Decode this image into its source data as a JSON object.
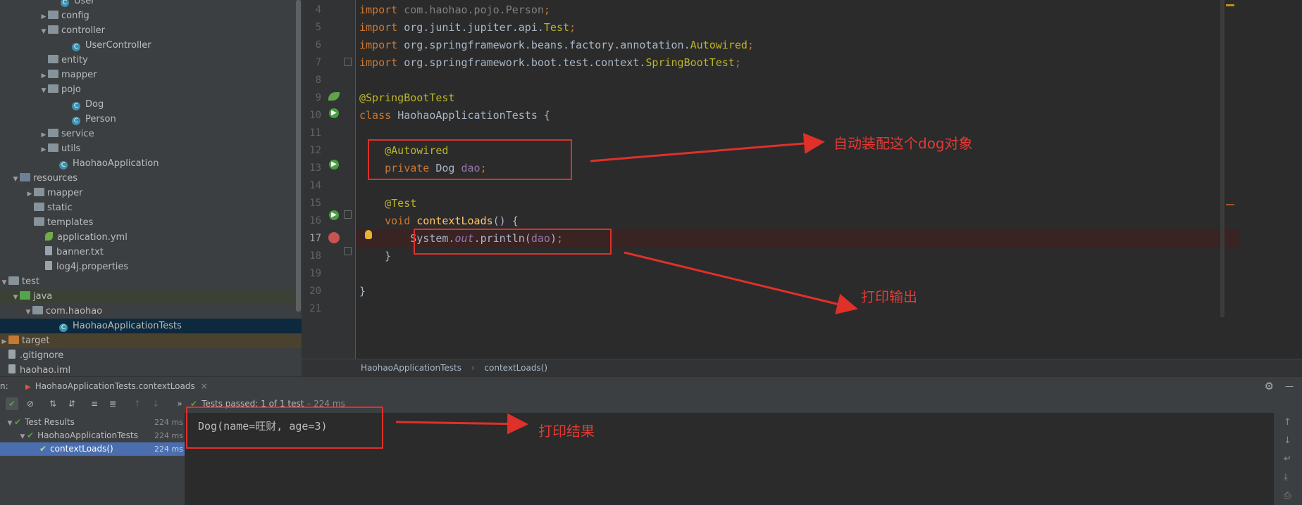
{
  "project_tree": [
    {
      "label": "User",
      "indent": 88,
      "icon": "class",
      "arrow": ""
    },
    {
      "label": "config",
      "indent": 70,
      "icon": "folder",
      "arrow": "▶"
    },
    {
      "label": "controller",
      "indent": 70,
      "icon": "folder",
      "arrow": "▼"
    },
    {
      "label": "UserController",
      "indent": 104,
      "icon": "class",
      "arrow": ""
    },
    {
      "label": "entity",
      "indent": 70,
      "icon": "folder",
      "arrow": ""
    },
    {
      "label": "mapper",
      "indent": 70,
      "icon": "folder",
      "arrow": "▶"
    },
    {
      "label": "pojo",
      "indent": 70,
      "icon": "folder",
      "arrow": "▼"
    },
    {
      "label": "Dog",
      "indent": 104,
      "icon": "class",
      "arrow": ""
    },
    {
      "label": "Person",
      "indent": 104,
      "icon": "class",
      "arrow": ""
    },
    {
      "label": "service",
      "indent": 70,
      "icon": "folder",
      "arrow": "▶"
    },
    {
      "label": "utils",
      "indent": 70,
      "icon": "folder",
      "arrow": "▶"
    },
    {
      "label": "HaohaoApplication",
      "indent": 86,
      "icon": "class",
      "arrow": ""
    },
    {
      "label": "resources",
      "indent": 30,
      "icon": "folder-src",
      "arrow": "▼"
    },
    {
      "label": "mapper",
      "indent": 50,
      "icon": "folder",
      "arrow": "▶"
    },
    {
      "label": "static",
      "indent": 50,
      "icon": "folder",
      "arrow": ""
    },
    {
      "label": "templates",
      "indent": 50,
      "icon": "folder",
      "arrow": ""
    },
    {
      "label": "application.yml",
      "indent": 66,
      "icon": "yml",
      "arrow": ""
    },
    {
      "label": "banner.txt",
      "indent": 66,
      "icon": "file",
      "arrow": ""
    },
    {
      "label": "log4j.properties",
      "indent": 66,
      "icon": "file",
      "arrow": ""
    },
    {
      "label": "test",
      "indent": 12,
      "icon": "folder",
      "arrow": "▼"
    },
    {
      "label": "java",
      "indent": 30,
      "icon": "folder-test",
      "arrow": "▼"
    },
    {
      "label": "com.haohao",
      "indent": 48,
      "icon": "folder",
      "arrow": "▼"
    },
    {
      "label": "HaohaoApplicationTests",
      "indent": 86,
      "icon": "class",
      "arrow": ""
    },
    {
      "label": "target",
      "indent": 0,
      "icon": "folder-orange",
      "arrow": "▶"
    },
    {
      "label": ".gitignore",
      "indent": 12,
      "icon": "file",
      "arrow": ""
    },
    {
      "label": "haohao.iml",
      "indent": 12,
      "icon": "file",
      "arrow": ""
    }
  ],
  "editor": {
    "line_numbers": [
      "4",
      "5",
      "6",
      "7",
      "8",
      "9",
      "10",
      "11",
      "12",
      "13",
      "14",
      "15",
      "16",
      "17",
      "18",
      "19",
      "20",
      "21"
    ],
    "lines": [
      [
        {
          "t": "import ",
          "c": "kw"
        },
        {
          "t": "com.haohao.pojo.Person",
          "c": "dim"
        },
        {
          "t": ";",
          "c": "kw"
        }
      ],
      [
        {
          "t": "import ",
          "c": "kw"
        },
        {
          "t": "org.junit.jupiter.api.",
          "c": ""
        },
        {
          "t": "Test",
          "c": "ann"
        },
        {
          "t": ";",
          "c": "kw"
        }
      ],
      [
        {
          "t": "import ",
          "c": "kw"
        },
        {
          "t": "org.springframework.beans.factory.annotation.",
          "c": ""
        },
        {
          "t": "Autowired",
          "c": "ann"
        },
        {
          "t": ";",
          "c": "kw"
        }
      ],
      [
        {
          "t": "import ",
          "c": "kw"
        },
        {
          "t": "org.springframework.boot.test.context.",
          "c": ""
        },
        {
          "t": "SpringBootTest",
          "c": "ann"
        },
        {
          "t": ";",
          "c": "kw"
        }
      ],
      [],
      [
        {
          "t": "@SpringBootTest",
          "c": "ann"
        }
      ],
      [
        {
          "t": "class ",
          "c": "kw"
        },
        {
          "t": "HaohaoApplicationTests ",
          "c": ""
        },
        {
          "t": "{",
          "c": ""
        }
      ],
      [],
      [
        {
          "t": "    @Autowired",
          "c": "ann"
        }
      ],
      [
        {
          "t": "    private ",
          "c": "kw"
        },
        {
          "t": "Dog ",
          "c": ""
        },
        {
          "t": "dao",
          "c": "fld"
        },
        {
          "t": ";",
          "c": "kw"
        }
      ],
      [],
      [
        {
          "t": "    @Test",
          "c": "ann"
        }
      ],
      [
        {
          "t": "    void ",
          "c": "kw"
        },
        {
          "t": "contextLoads",
          "c": "fn"
        },
        {
          "t": "() {",
          "c": ""
        }
      ],
      [
        {
          "t": "        System.",
          "c": ""
        },
        {
          "t": "out",
          "c": "sfld"
        },
        {
          "t": ".println(",
          "c": ""
        },
        {
          "t": "dao",
          "c": "fld"
        },
        {
          "t": ")",
          "c": ""
        },
        {
          "t": ";",
          "c": "kw"
        }
      ],
      [
        {
          "t": "    }",
          "c": ""
        }
      ],
      [],
      [
        {
          "t": "}",
          "c": ""
        }
      ],
      []
    ]
  },
  "breadcrumb": {
    "class": "HaohaoApplicationTests",
    "method": "contextLoads()"
  },
  "run_panel": {
    "prefix": "n:",
    "tab_label": "HaohaoApplicationTests.contextLoads",
    "status_prefix": "Tests passed:",
    "status_count": "1",
    "status_suffix": "of 1 test",
    "status_time": "– 224 ms",
    "results": [
      {
        "label": "Test Results",
        "ms": "224 ms",
        "arrow": "▼"
      },
      {
        "label": "HaohaoApplicationTests",
        "ms": "224 ms",
        "arrow": "▼"
      },
      {
        "label": "contextLoads()",
        "ms": "224 ms",
        "arrow": ""
      }
    ],
    "console_output": "Dog(name=旺财, age=3)"
  },
  "annotations": {
    "autowire_note": "自动装配这个dog对象",
    "print_note": "打印输出",
    "result_note": "打印结果",
    "color": "#e0302a"
  }
}
